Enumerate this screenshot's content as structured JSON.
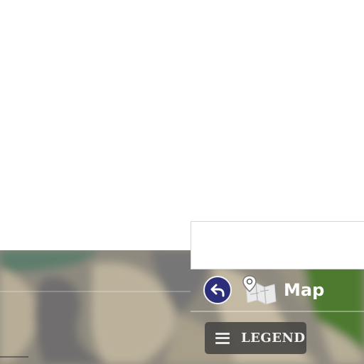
{
  "search": {
    "value": ""
  },
  "toolbar": {
    "back_button_icon": "back-arrow-icon",
    "map_icon": "folded-map-pin-icon",
    "map_label": "Map"
  },
  "legend_button": {
    "icon": "hamburger-icon",
    "label": "LEGEND"
  },
  "colors": {
    "back_button_bg": "#2c2e7a",
    "terrain": "#8f8a7f",
    "grass": "#4e7a2e",
    "water": "#6e8a7a",
    "legend_bg": "#464442"
  }
}
